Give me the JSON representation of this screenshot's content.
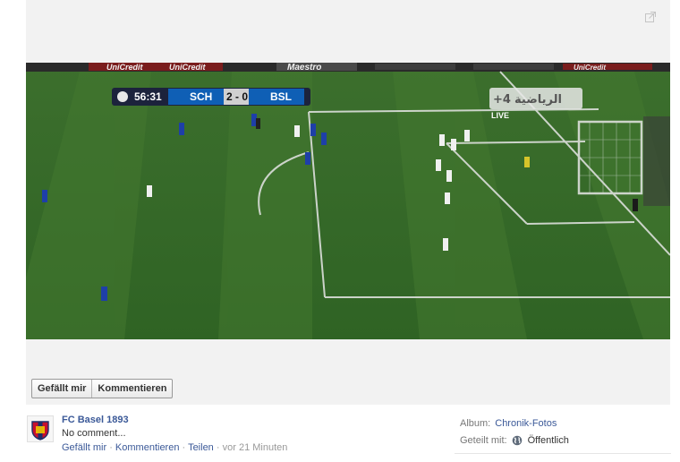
{
  "photo": {
    "scorebug": {
      "time": "56:31",
      "home_team": "SCH",
      "score": "2 - 0",
      "away_team": "BSL"
    },
    "channel": {
      "logo_text": "الرياضية",
      "number": "+4",
      "live_label": "LIVE"
    },
    "ad_boards": [
      "UniCredit",
      "UniCredit",
      "Maestro",
      "UniCredit"
    ]
  },
  "actions": {
    "like_label": "Gefällt mir",
    "comment_label": "Kommentieren"
  },
  "post": {
    "author": "FC Basel 1893",
    "comment": "No comment...",
    "meta": {
      "like": "Gefällt mir",
      "comment": "Kommentieren",
      "share": "Teilen",
      "time": "vor 21 Minuten"
    }
  },
  "details": {
    "album_label": "Album:",
    "album_value": "Chronik-Fotos",
    "shared_label": "Geteilt mit:",
    "shared_value": "Öffentlich"
  }
}
